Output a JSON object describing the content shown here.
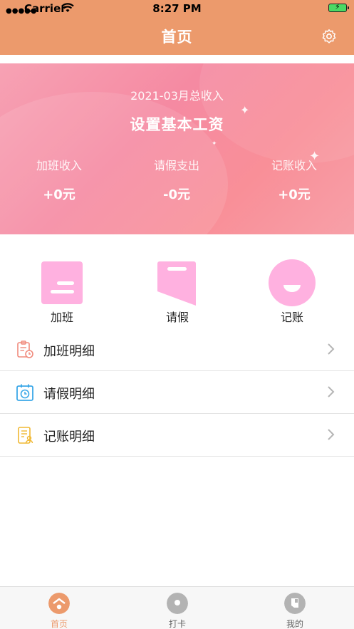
{
  "status_bar": {
    "carrier": "Carrier",
    "time": "8:27 PM"
  },
  "header": {
    "title": "首页"
  },
  "banner": {
    "subtitle": "2021-03月总收入",
    "main": "设置基本工资",
    "stats": [
      {
        "label": "加班收入",
        "value": "+0元"
      },
      {
        "label": "请假支出",
        "value": "-0元"
      },
      {
        "label": "记账收入",
        "value": "+0元"
      }
    ]
  },
  "quick_actions": [
    {
      "label": "加班",
      "icon": "overtime-icon"
    },
    {
      "label": "请假",
      "icon": "leave-icon"
    },
    {
      "label": "记账",
      "icon": "bookkeeping-icon"
    }
  ],
  "rows": [
    {
      "label": "加班明细",
      "icon": "clipboard-clock-icon"
    },
    {
      "label": "请假明细",
      "icon": "alarm-calendar-icon"
    },
    {
      "label": "记账明细",
      "icon": "ledger-icon"
    }
  ],
  "tabbar": {
    "tabs": [
      {
        "label": "首页",
        "active": true
      },
      {
        "label": "打卡",
        "active": false
      },
      {
        "label": "我的",
        "active": false
      }
    ]
  },
  "colors": {
    "header": "#ec9a6c",
    "accent_pink": "#ffb1e0",
    "tab_active": "#ec9a6c",
    "tab_inactive_text": "#666666"
  }
}
